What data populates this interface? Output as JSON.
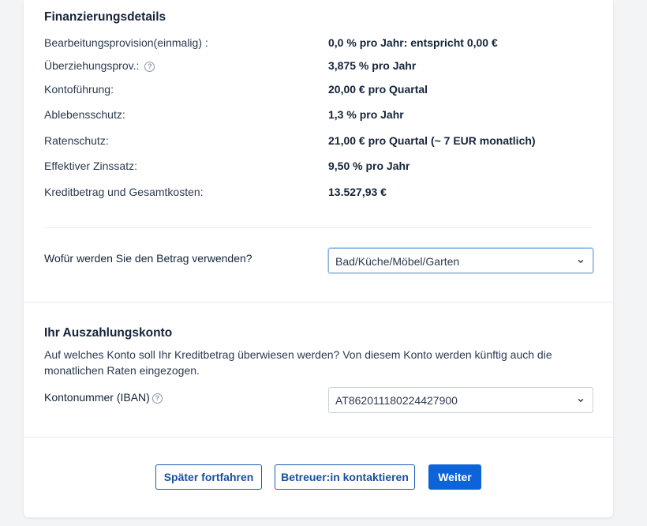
{
  "financing": {
    "title": "Finanzierungsdetails",
    "rows": [
      {
        "label": "Bearbeitungsprovision(einmalig) :",
        "value": "0,0 % pro Jahr: entspricht 0,00 €",
        "help": false
      },
      {
        "label": "Überziehungsprov.:",
        "value": "3,875 % pro Jahr",
        "help": true
      },
      {
        "label": "Kontoführung:",
        "value": "20,00 € pro Quartal",
        "help": false
      },
      {
        "label": "Ablebensschutz:",
        "value": "1,3 % pro Jahr",
        "help": false
      },
      {
        "label": "Ratenschutz:",
        "value": "21,00 € pro Quartal (~ 7 EUR monatlich)",
        "help": false
      },
      {
        "label": "Effektiver Zinssatz:",
        "value": "9,50 % pro Jahr",
        "help": false
      },
      {
        "label": "Kreditbetrag und Gesamtkosten:",
        "value": "13.527,93 €",
        "help": false
      }
    ]
  },
  "purpose": {
    "label": "Wofür werden Sie den Betrag verwenden?",
    "selected": "Bad/Küche/Möbel/Garten"
  },
  "payout": {
    "title": "Ihr Auszahlungskonto",
    "description_line1": "Auf welches Konto soll Ihr Kreditbetrag überwiesen werden? Von diesem Konto werden künftig auch die",
    "description_line2": "monatlichen Raten eingezogen.",
    "iban_label": "Kontonummer (IBAN)",
    "iban_selected": "AT862011180224427900"
  },
  "actions": {
    "later": "Später fortfahren",
    "contact": "Betreuer:in kontaktieren",
    "next": "Weiter"
  },
  "icons": {
    "help": "help-circle-icon",
    "dropdown": "chevron-down-icon"
  },
  "colors": {
    "primary": "#0d63d8",
    "text": "#15243a"
  }
}
